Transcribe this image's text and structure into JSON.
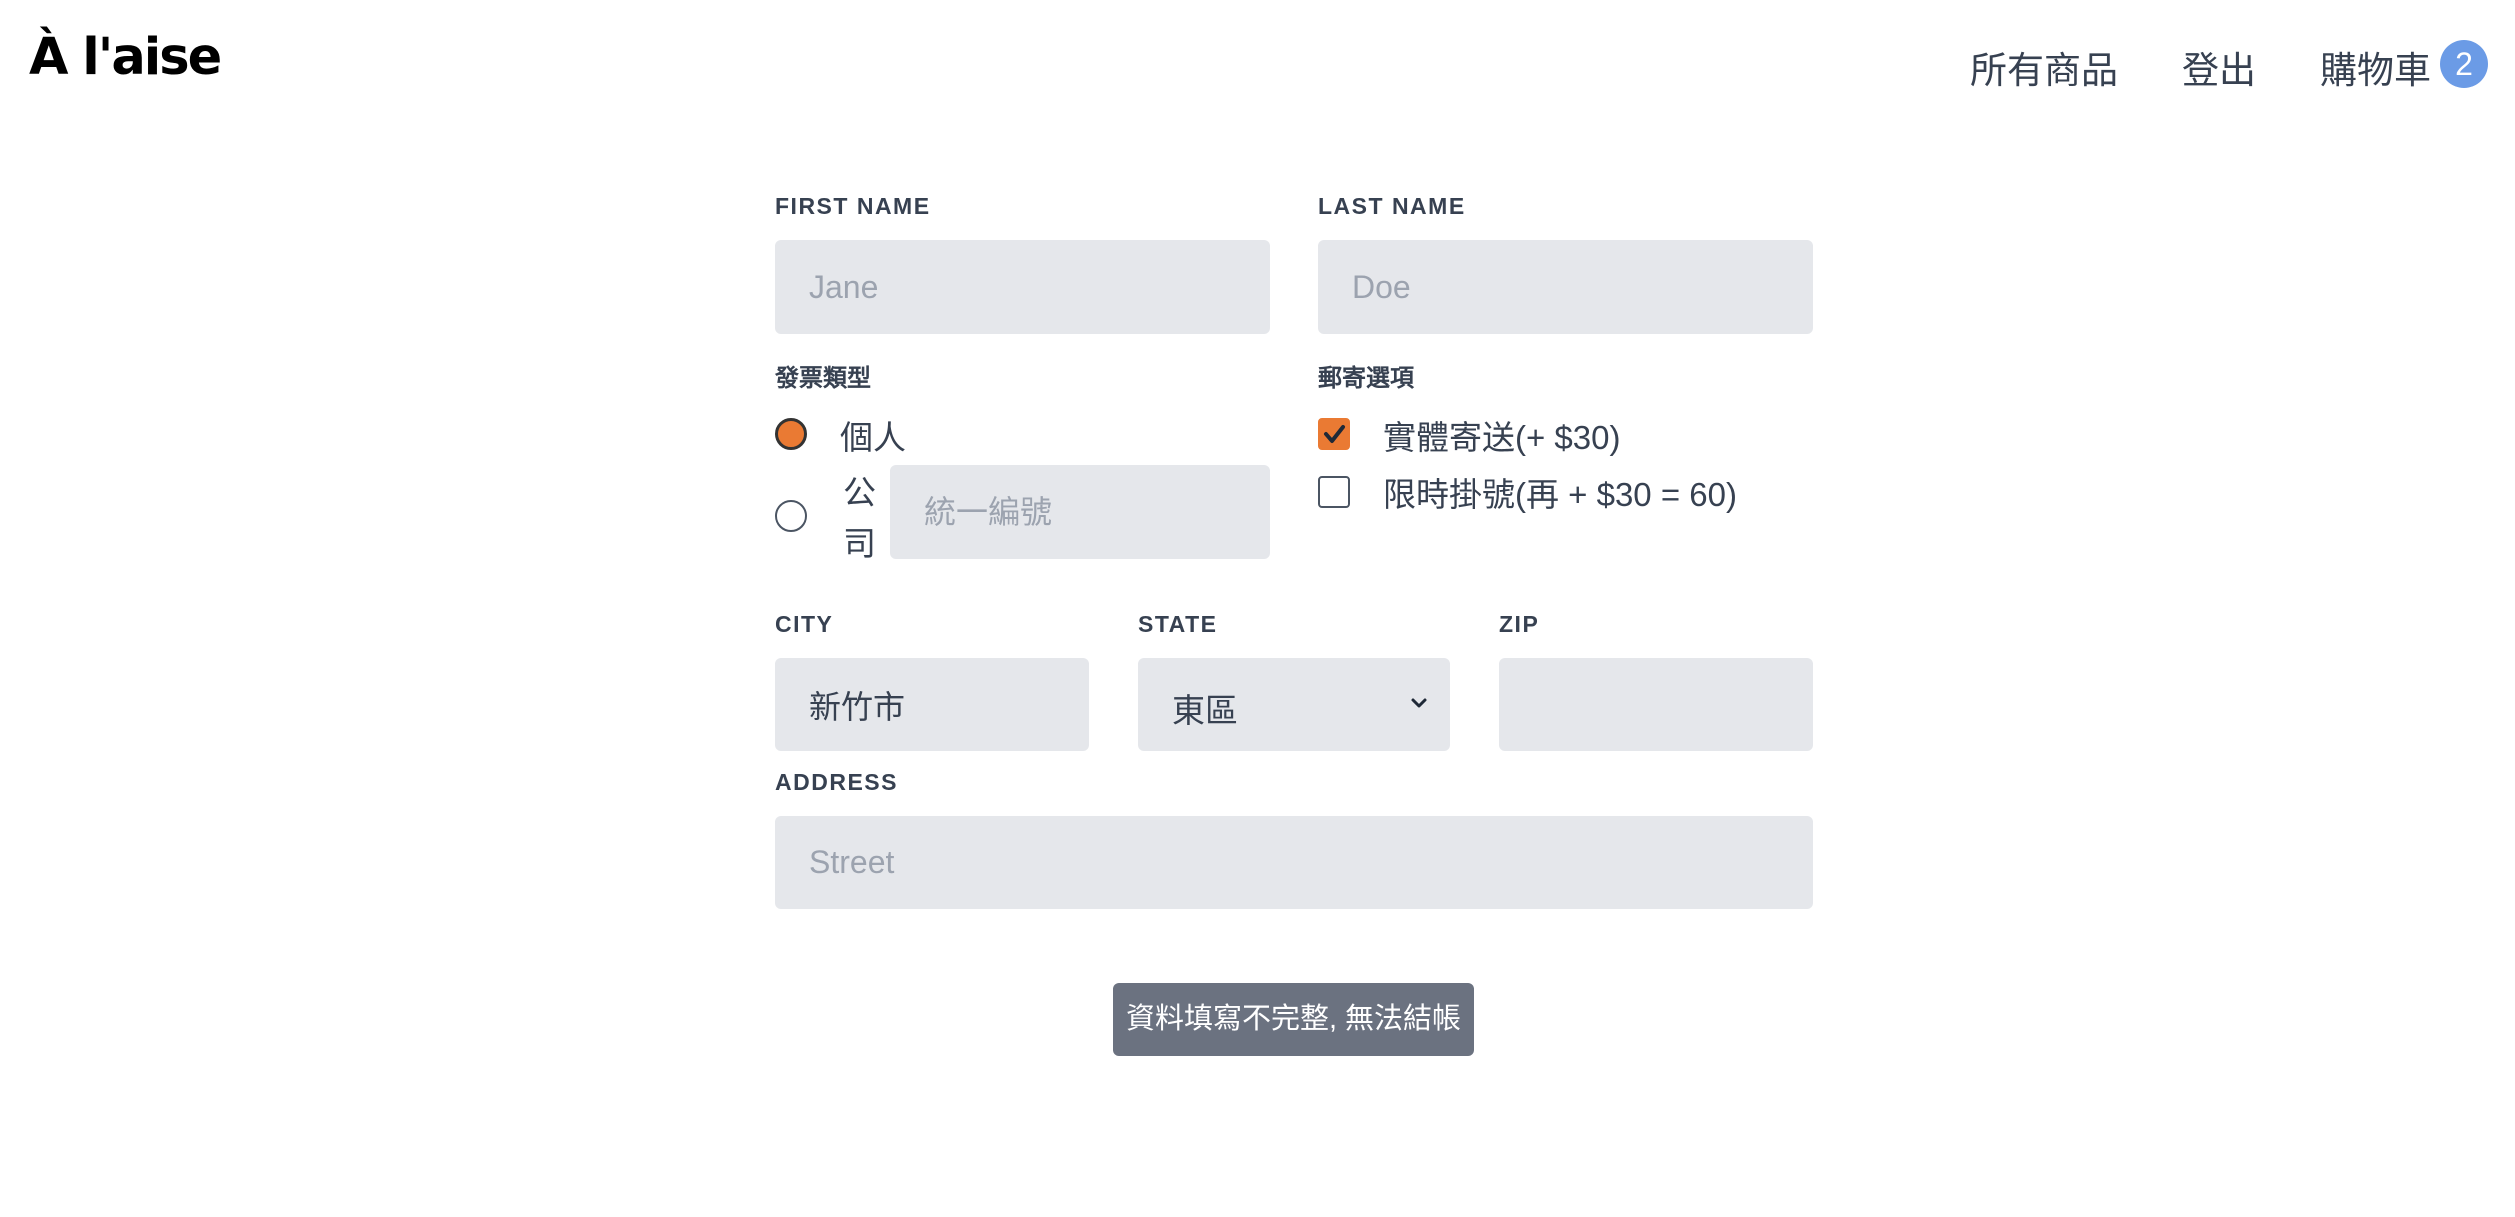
{
  "header": {
    "logo": "À l'aise",
    "nav": {
      "all_products": "所有商品",
      "logout": "登出",
      "cart": "購物車",
      "cart_count": "2"
    }
  },
  "form": {
    "first_name": {
      "label": "FIRST NAME",
      "placeholder": "Jane",
      "value": ""
    },
    "last_name": {
      "label": "LAST NAME",
      "placeholder": "Doe",
      "value": ""
    },
    "invoice_type": {
      "label": "發票類型",
      "options": [
        {
          "label": "個人",
          "checked": true
        },
        {
          "label_line1": "公",
          "label_line2": "司",
          "checked": false
        }
      ],
      "tax_id_placeholder": "統一編號"
    },
    "shipping": {
      "label": "郵寄選項",
      "options": [
        {
          "label": "實體寄送(+ $30)",
          "checked": true
        },
        {
          "label": "限時掛號(再 + $30 = 60)",
          "checked": false
        }
      ]
    },
    "city": {
      "label": "CITY",
      "value": "新竹市"
    },
    "state": {
      "label": "STATE",
      "value": "東區"
    },
    "zip": {
      "label": "ZIP",
      "value": ""
    },
    "address": {
      "label": "ADDRESS",
      "placeholder": "Street",
      "value": ""
    }
  },
  "alert": {
    "text": "資料填寫不完整, 無法結帳"
  },
  "colors": {
    "accent": "#ea7a33",
    "badge": "#6b9be6",
    "input_bg": "#e5e7eb",
    "alert_bg": "#6b7280"
  }
}
